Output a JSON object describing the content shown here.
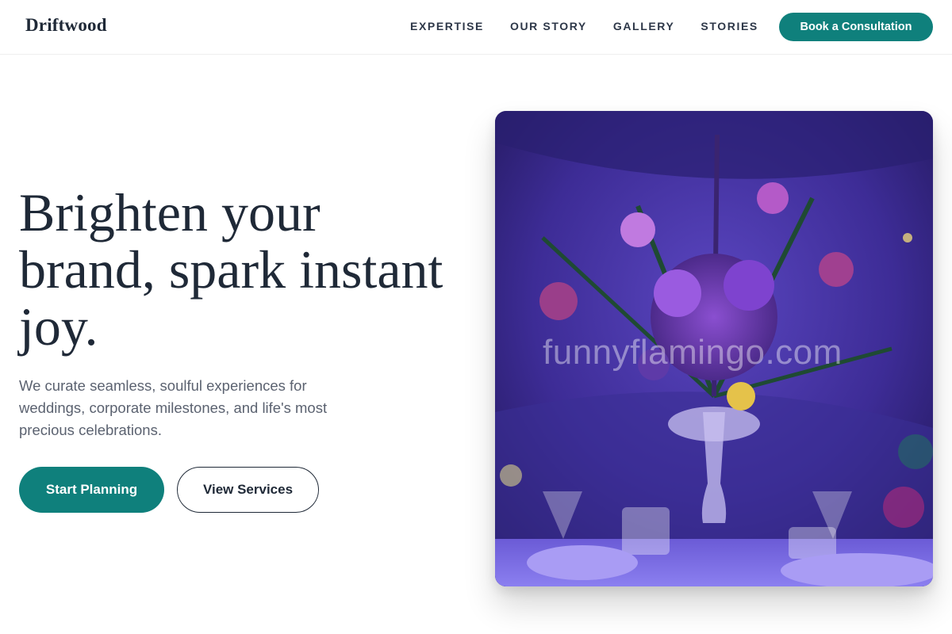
{
  "header": {
    "brand": "Driftwood",
    "nav": [
      "EXPERTISE",
      "OUR STORY",
      "GALLERY",
      "STORIES"
    ],
    "cta_label": "Book a Consultation"
  },
  "hero": {
    "title": "Brighten your brand, spark instant joy.",
    "subtitle": "We curate seamless, soulful experiences for weddings, corporate milestones, and life's most precious celebrations.",
    "primary_label": "Start Planning",
    "secondary_label": "View Services",
    "image": {
      "watermark": "funnyflamingo.com"
    }
  },
  "colors": {
    "accent": "#0f807c",
    "text": "#1f2937",
    "muted": "#5b6270",
    "image_base": "#3b2a8c"
  },
  "icons": [
    "centerpiece-photo"
  ]
}
